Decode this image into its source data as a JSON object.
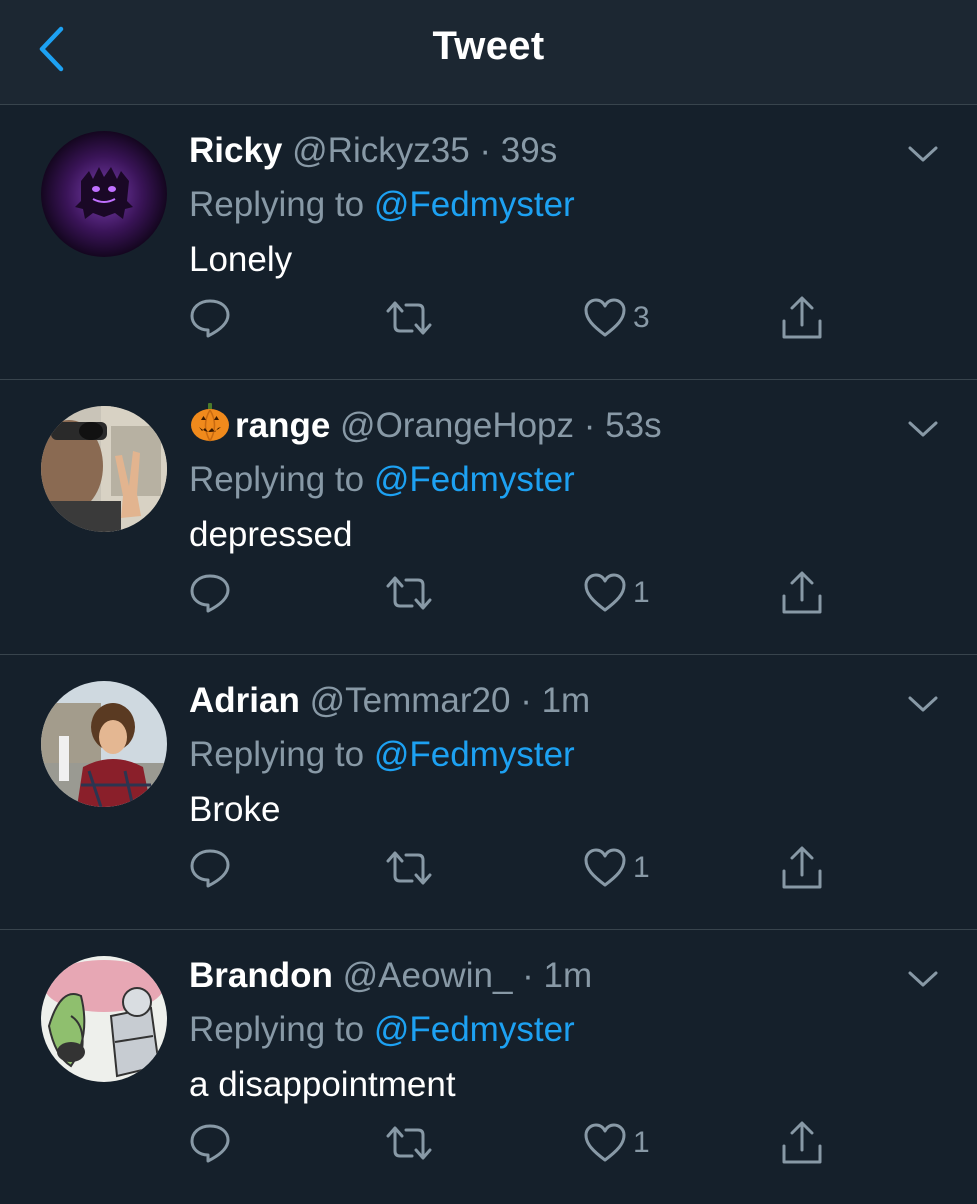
{
  "header": {
    "title": "Tweet",
    "back_icon": "chevron-left-icon",
    "accent": "#1da1f2"
  },
  "colors": {
    "background": "#15202b",
    "header": "#1c2732",
    "divider": "#38444d",
    "secondary_text": "#8899a6",
    "mention": "#1da1f2"
  },
  "tweets": [
    {
      "name": "Ricky",
      "handle": "@Rickyz35",
      "separator": "·",
      "time": "39s",
      "replying_label": "Replying to",
      "replying_to": "@Fedmyster",
      "text": "Lonely",
      "likes": "3"
    },
    {
      "name": "range",
      "name_emoji": "jack-o-lantern",
      "handle": "@OrangeHopz",
      "separator": "·",
      "time": "53s",
      "replying_label": "Replying to",
      "replying_to": "@Fedmyster",
      "text": "depressed",
      "likes": "1"
    },
    {
      "name": "Adrian",
      "handle": "@Temmar20",
      "separator": "·",
      "time": "1m",
      "replying_label": "Replying to",
      "replying_to": "@Fedmyster",
      "text": "Broke",
      "likes": "1"
    },
    {
      "name": "Brandon",
      "handle": "@Aeowin_",
      "separator": "·",
      "time": "1m",
      "replying_label": "Replying to",
      "replying_to": "@Fedmyster",
      "text": "a disappointment",
      "likes": "1"
    }
  ],
  "icons": [
    "reply-icon",
    "retweet-icon",
    "like-icon",
    "share-icon",
    "chevron-down-icon"
  ]
}
